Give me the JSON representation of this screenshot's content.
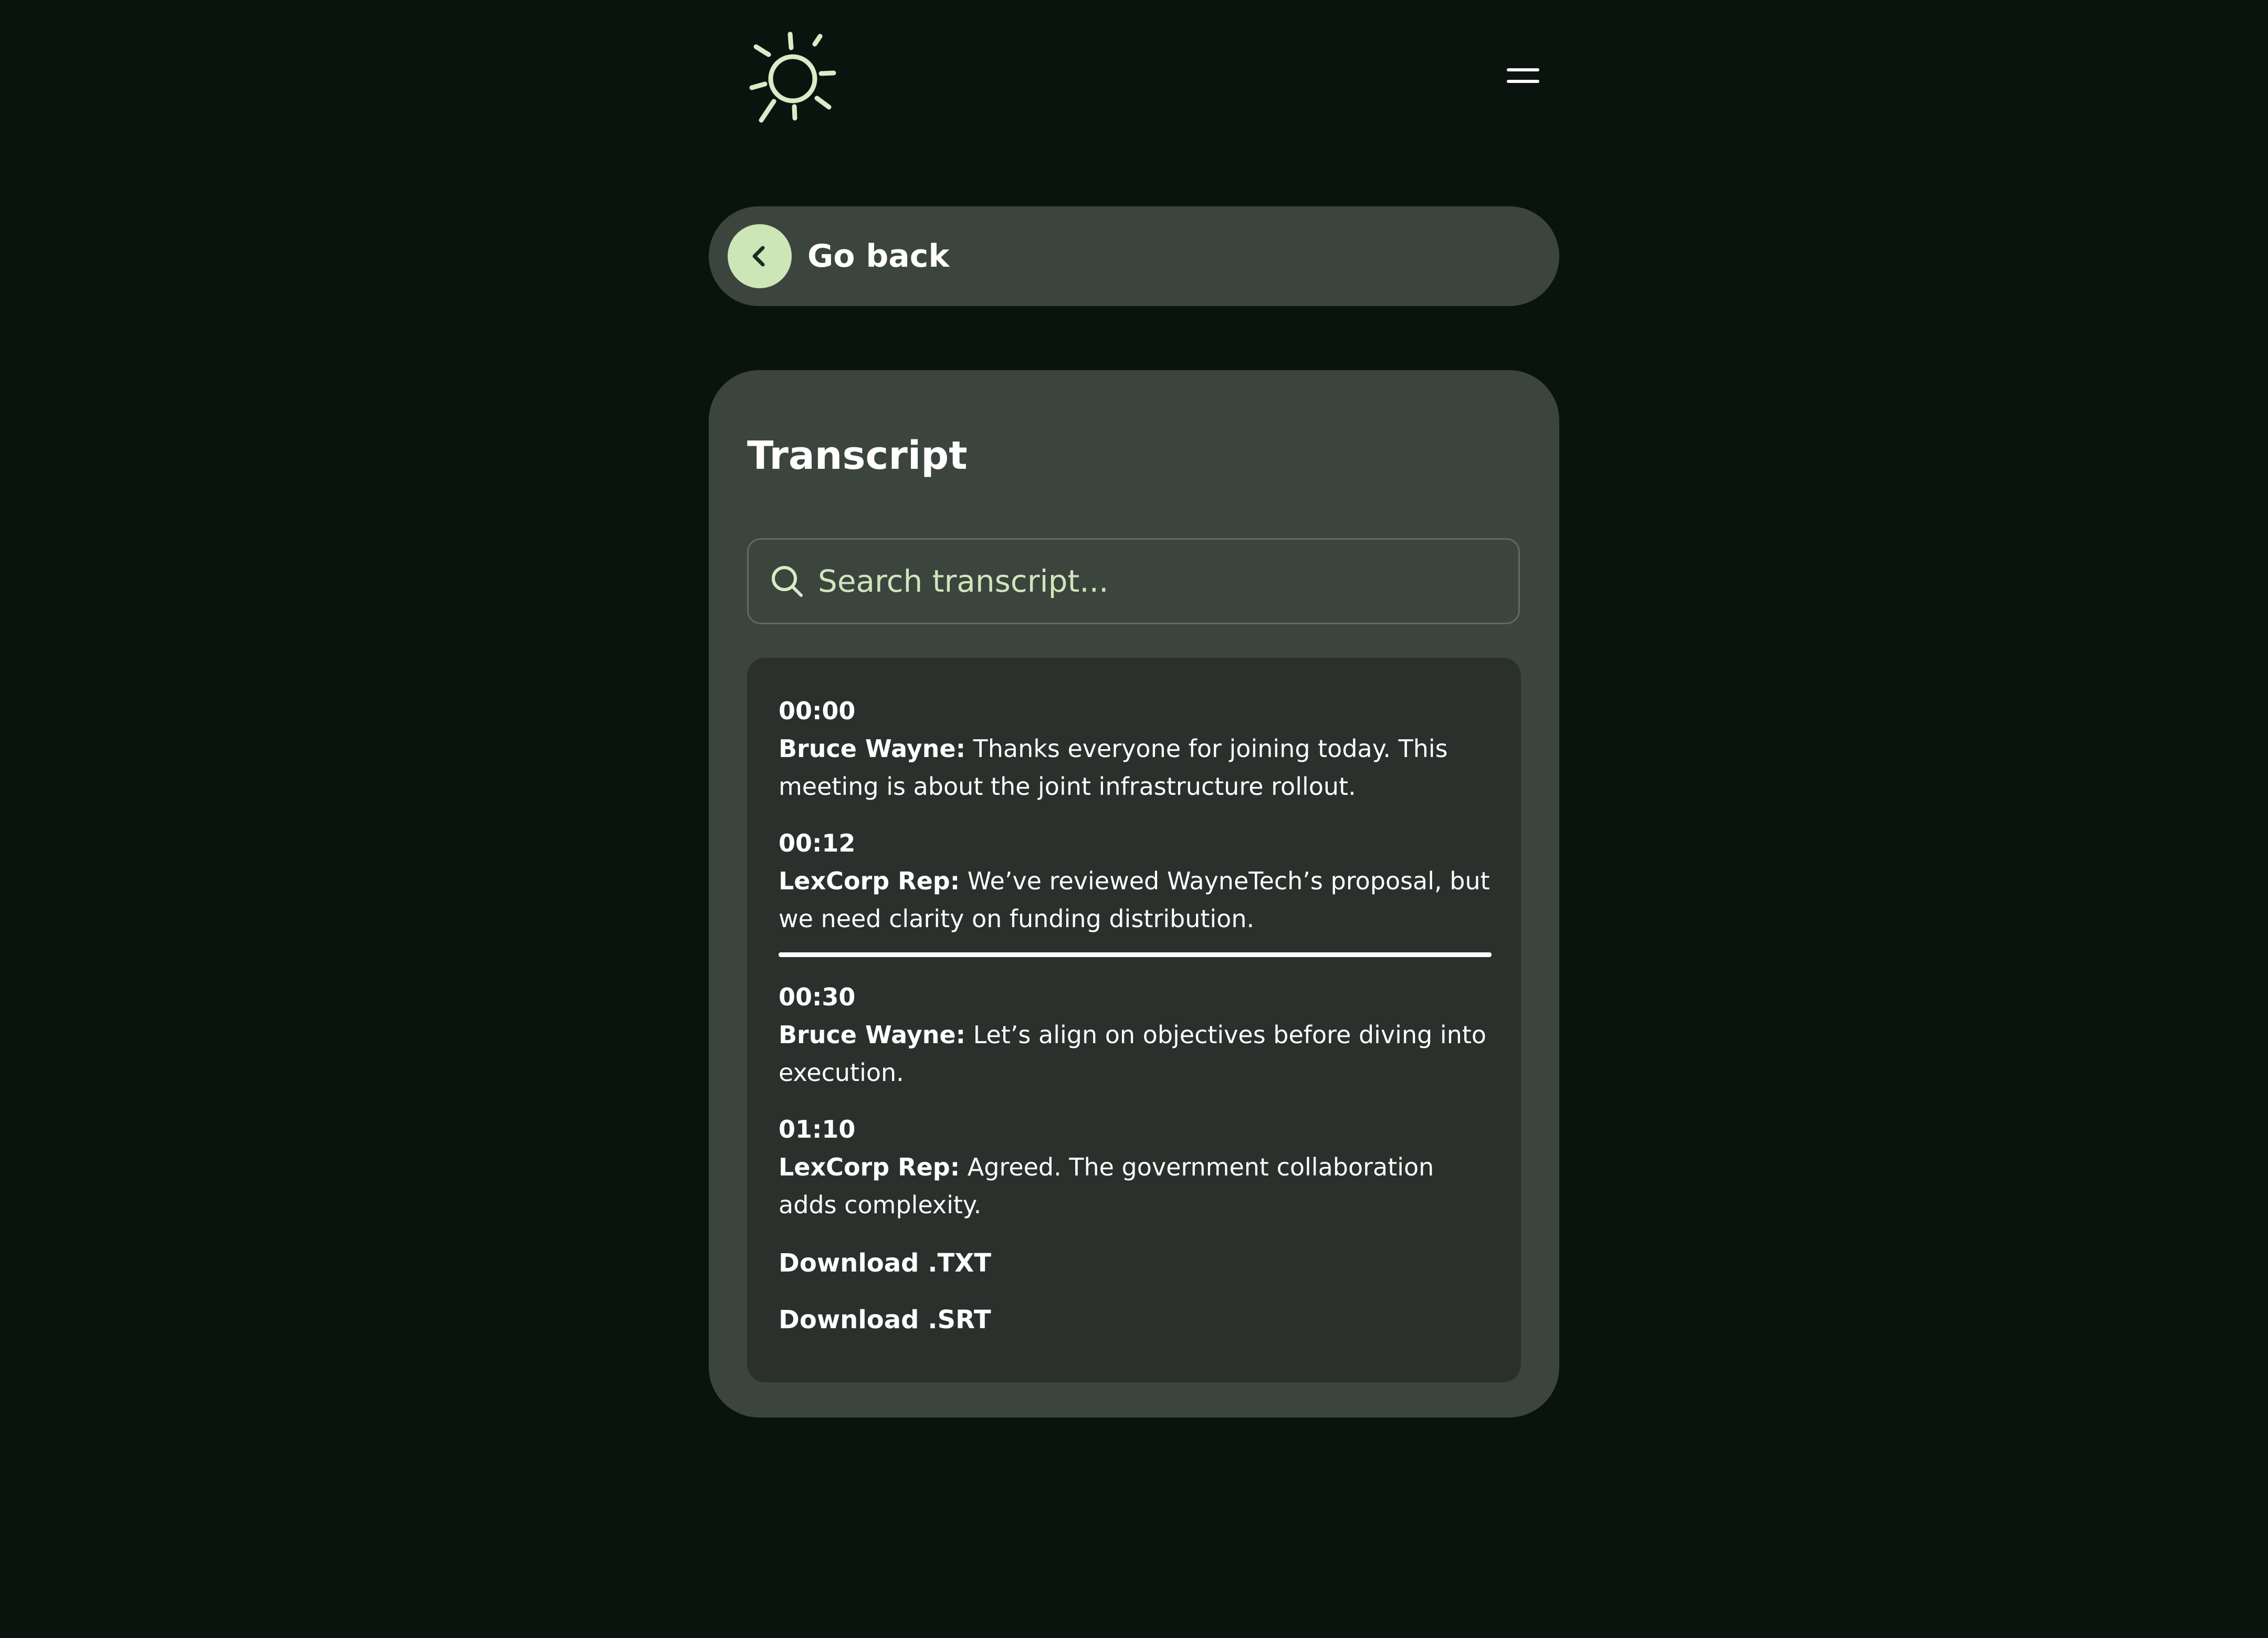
{
  "header": {
    "logo_icon": "sun-logo-icon",
    "menu_icon": "hamburger-menu-icon"
  },
  "back": {
    "label": "Go back",
    "icon": "chevron-left-icon"
  },
  "transcript": {
    "title": "Transcript",
    "search": {
      "placeholder": "Search transcript...",
      "value": "",
      "icon": "search-icon"
    },
    "entries": [
      {
        "time": "00:00",
        "speaker": "Bruce Wayne:",
        "text": " Thanks everyone for joining today. This meeting is about the joint infrastructure rollout."
      },
      {
        "time": "00:12",
        "speaker": "LexCorp Rep:",
        "text": " We’ve reviewed WayneTech’s proposal, but we need clarity on funding distribution."
      },
      {
        "time": "00:30",
        "speaker": "Bruce Wayne:",
        "text": " Let’s align on objectives before diving into execution."
      },
      {
        "time": "01:10",
        "speaker": "LexCorp Rep:",
        "text": " Agreed. The government collaboration adds complexity."
      }
    ],
    "downloads": {
      "txt_label": "Download .TXT",
      "srt_label": "Download .SRT"
    }
  },
  "colors": {
    "background": "#0a140f",
    "card": "#3b453e",
    "panel": "#2b302d",
    "accent": "#cde6b8",
    "text": "#ffffff"
  }
}
